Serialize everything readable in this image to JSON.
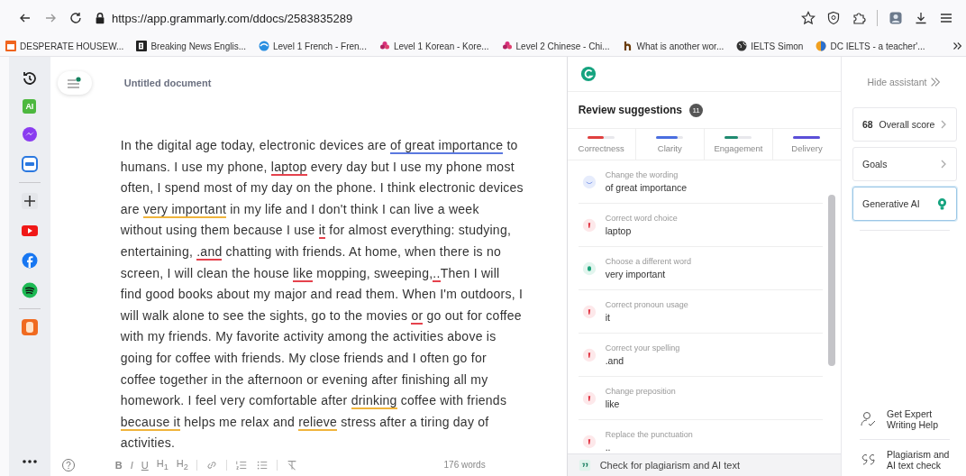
{
  "browser": {
    "url": "https://app.grammarly.com/ddocs/2583835289"
  },
  "bookmarks": [
    {
      "label": "DESPERATE HOUSEW...",
      "kind": "tile"
    },
    {
      "label": "Breaking News Englis...",
      "kind": "dark"
    },
    {
      "label": "Level 1 French - Fren...",
      "kind": "swirl"
    },
    {
      "label": "Level 1 Korean - Kore...",
      "kind": "flower"
    },
    {
      "label": "Level 2 Chinese - Chi...",
      "kind": "flower"
    },
    {
      "label": "What is another wor...",
      "kind": "hook"
    },
    {
      "label": "IELTS Simon",
      "kind": "globe"
    },
    {
      "label": "DC IELTS - a teacher'...",
      "kind": "ball"
    }
  ],
  "apps": [
    {
      "kind": "history"
    },
    {
      "kind": "ai",
      "label": "AI"
    },
    {
      "kind": "messenger"
    },
    {
      "kind": "zalo"
    },
    {
      "kind": "plus"
    },
    {
      "kind": "youtube"
    },
    {
      "kind": "facebook"
    },
    {
      "kind": "spotify"
    },
    {
      "kind": "app"
    }
  ],
  "editor": {
    "title": "Untitled document",
    "segments": [
      {
        "text": "In the digital age today, electronic devices are "
      },
      {
        "text": "of great importance",
        "kind": "clarity"
      },
      {
        "text": " to humans. I use my phone, "
      },
      {
        "text": "laptop",
        "kind": "correctness"
      },
      {
        "text": " every day but I use my phone most often, I spend most of my day on the phone. I think electronic devices are "
      },
      {
        "text": "very important",
        "kind": "engagement"
      },
      {
        "text": " in my life and I don't think I can live a week without using them because I use "
      },
      {
        "text": "it",
        "kind": "correctness"
      },
      {
        "text": " for almost everything: studying, entertaining, "
      },
      {
        "text": ".and",
        "kind": "correctness"
      },
      {
        "text": " chatting with friends. At home, when there is no screen, I will clean the house "
      },
      {
        "text": "like",
        "kind": "correctness"
      },
      {
        "text": " mopping, sweeping,"
      },
      {
        "text": "..",
        "kind": "correctness"
      },
      {
        "text": "Then I will find good books about my major and read them. When I'm outdoors, I will walk alone to see the sights, go to the movies "
      },
      {
        "text": "or",
        "kind": "correctness"
      },
      {
        "text": " go out for coffee with my friends. My favorite activity among the activities above is going for coffee with friends. My close friends and I often go for coffee together in the afternoon or evening after finishing all my homework. I feel very comfortable after "
      },
      {
        "text": "drinking",
        "kind": "engagement"
      },
      {
        "text": " coffee with friends "
      },
      {
        "text": "because it",
        "kind": "engagement"
      },
      {
        "text": " helps me relax and "
      },
      {
        "text": "relieve",
        "kind": "engagement"
      },
      {
        "text": " stress after a tiring day of activities."
      }
    ],
    "format_buttons": [
      "B",
      "I",
      "U",
      "H$_{1}$",
      "H$_{2}$"
    ],
    "word_count": "176 words"
  },
  "review": {
    "title": "Review suggestions",
    "count": "11",
    "tabs": [
      {
        "label": "Correctness",
        "level": 0.6,
        "color": "#e0403f"
      },
      {
        "label": "Clarity",
        "level": 0.8,
        "color": "#4a6ee0"
      },
      {
        "label": "Engagement",
        "level": 0.5,
        "color": "#1f8a70"
      },
      {
        "label": "Delivery",
        "level": 1,
        "color": "#5b4fd8"
      }
    ],
    "suggestions": [
      {
        "title": "Change the wording",
        "text": "of great importance",
        "kind": "clarity"
      },
      {
        "title": "Correct word choice",
        "text": "laptop",
        "kind": "correctness"
      },
      {
        "title": "Choose a different word",
        "text": "very important",
        "kind": "engagement"
      },
      {
        "title": "Correct pronoun usage",
        "text": "it",
        "kind": "correctness"
      },
      {
        "title": "Correct your spelling",
        "text": ".and",
        "kind": "correctness"
      },
      {
        "title": "Change preposition",
        "text": "like",
        "kind": "correctness"
      },
      {
        "title": "Replace the punctuation",
        "text": "..",
        "kind": "correctness"
      }
    ],
    "footer": "Check for plagiarism and AI text"
  },
  "assistant": {
    "hide": "Hide assistant",
    "cards": [
      {
        "score": "68",
        "label": "Overall score",
        "kind": "chevron",
        "selected": false
      },
      {
        "label": "Goals",
        "kind": "chevron",
        "selected": false
      },
      {
        "label": "Generative AI",
        "kind": "bulb",
        "selected": true
      }
    ],
    "links": [
      {
        "label": "Get Expert Writing Help",
        "kind": "expert"
      },
      {
        "label": "Plagiarism and AI text check",
        "kind": "quote"
      }
    ]
  }
}
